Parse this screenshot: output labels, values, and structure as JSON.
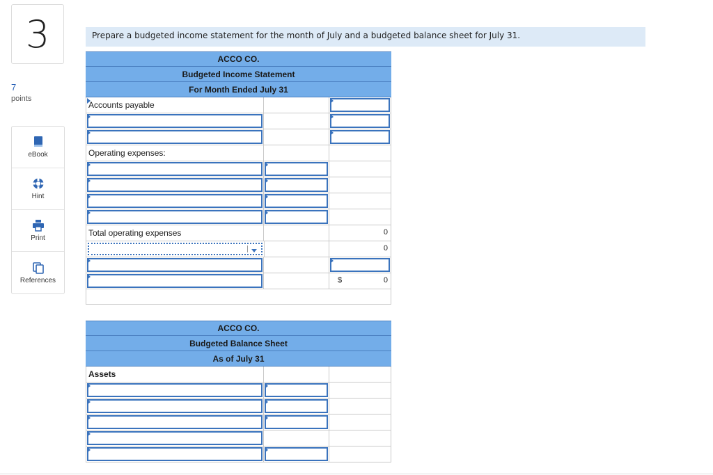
{
  "question": {
    "number": "3",
    "points_value": "7",
    "points_label": "points"
  },
  "tools": [
    {
      "label": "eBook",
      "icon": "book-icon"
    },
    {
      "label": "Hint",
      "icon": "lifebuoy-icon"
    },
    {
      "label": "Print",
      "icon": "printer-icon"
    },
    {
      "label": "References",
      "icon": "copy-icon"
    }
  ],
  "prompt": "Prepare a budgeted income statement for the month of July and a budgeted balance sheet for July 31.",
  "income_statement": {
    "company": "ACCO CO.",
    "title": "Budgeted Income Statement",
    "period": "For Month Ended July 31",
    "rows": {
      "accounts_payable": "Accounts payable",
      "operating_expenses": "Operating expenses:",
      "total_operating_expenses": "Total operating expenses",
      "total_value": "0",
      "dropdown_row_value": "0",
      "dollar_sign": "$",
      "final_value": "0"
    }
  },
  "balance_sheet": {
    "company": "ACCO CO.",
    "title": "Budgeted Balance Sheet",
    "period": "As of July 31",
    "assets_label": "Assets"
  },
  "colors": {
    "header": "#73ade9",
    "input_border": "#3a73bd",
    "prompt_bg": "#ddeaf7"
  }
}
